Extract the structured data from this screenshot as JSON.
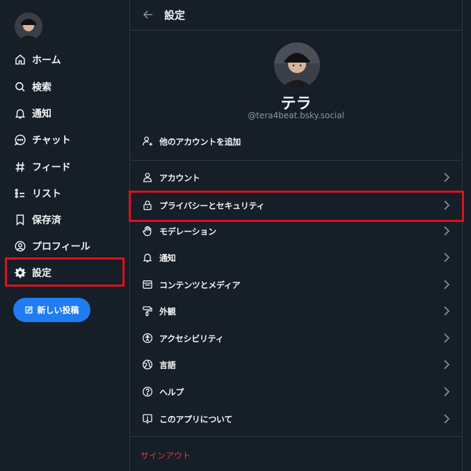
{
  "sidebar": {
    "items": [
      {
        "label": "ホーム",
        "icon": "home-icon"
      },
      {
        "label": "検索",
        "icon": "search-icon"
      },
      {
        "label": "通知",
        "icon": "bell-icon"
      },
      {
        "label": "チャット",
        "icon": "chat-icon"
      },
      {
        "label": "フィード",
        "icon": "hash-icon"
      },
      {
        "label": "リスト",
        "icon": "list-icon"
      },
      {
        "label": "保存済",
        "icon": "bookmark-icon"
      },
      {
        "label": "プロフィール",
        "icon": "profile-icon"
      },
      {
        "label": "設定",
        "icon": "gear-icon"
      }
    ],
    "new_post_label": "新しい投稿"
  },
  "header": {
    "title": "設定"
  },
  "profile": {
    "name": "テラ",
    "handle": "@tera4beat.bsky.social"
  },
  "add_account_label": "他のアカウントを追加",
  "settings_items": [
    {
      "label": "アカウント",
      "icon": "person-icon"
    },
    {
      "label": "プライバシーとセキュリティ",
      "icon": "lock-icon"
    },
    {
      "label": "モデレーション",
      "icon": "hand-icon"
    },
    {
      "label": "通知",
      "icon": "bell-icon"
    },
    {
      "label": "コンテンツとメディア",
      "icon": "window-icon"
    },
    {
      "label": "外観",
      "icon": "paint-roller-icon"
    },
    {
      "label": "アクセシビリティ",
      "icon": "accessibility-icon"
    },
    {
      "label": "言語",
      "icon": "globe-icon"
    },
    {
      "label": "ヘルプ",
      "icon": "help-icon"
    },
    {
      "label": "このアプリについて",
      "icon": "info-icon"
    }
  ],
  "signout_label": "サインアウト",
  "colors": {
    "background": "#161e27",
    "accent": "#1f7cf2",
    "highlight": "#e0101e",
    "signout": "#e8334a"
  }
}
